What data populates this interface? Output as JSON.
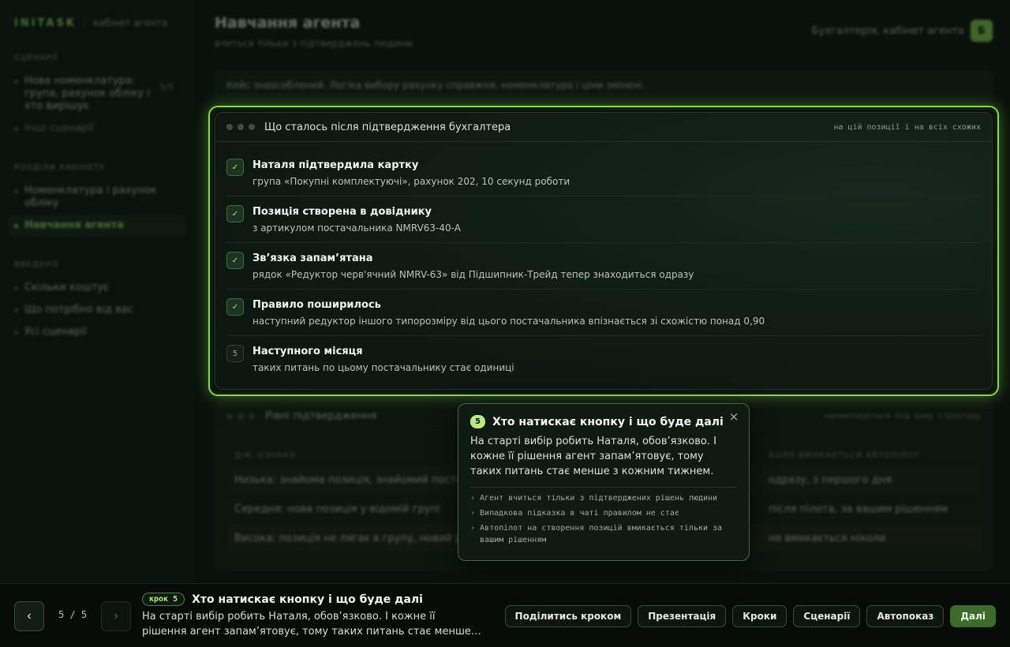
{
  "brand": {
    "logo": "INITASK",
    "subtitle": "кабінет агента"
  },
  "sidebar": {
    "sections": [
      {
        "title": "СЦЕНАРІЇ",
        "items": [
          {
            "label": "Нова номенклатура: група, рахунок обліку і хто вирішує",
            "count": "5/5"
          },
          {
            "label": "Інші сценарії"
          }
        ]
      },
      {
        "title": "РОЗДІЛИ КАБІНЕТУ",
        "items": [
          {
            "label": "Номенклатура і рахунок обліку"
          },
          {
            "label": "Навчання агента"
          }
        ]
      },
      {
        "title": "ВВЕДЕНО",
        "items": [
          {
            "label": "Скільки коштує"
          },
          {
            "label": "Що потрібно від вас"
          },
          {
            "label": "Усі сценарії"
          }
        ]
      }
    ]
  },
  "header": {
    "title": "Навчання агента",
    "subtitle": "вчиться тільки з підтверджень людини",
    "account_label": "Бухгалтерія, кабінет агента",
    "avatar_letter": "Б"
  },
  "banner": {
    "text": "Кейс знеособлений. Логіка вибору рахунку справжня, номенклатура і ціни змінені."
  },
  "window": {
    "title": "Що сталось після підтвердження бухгалтера",
    "note": "на цій позиції і на всіх схожих",
    "steps": [
      {
        "mark": "✓",
        "title": "Наталя підтвердила картку",
        "desc": "група «Покупні комплектуючі», рахунок 202, 10 секунд роботи"
      },
      {
        "mark": "✓",
        "title": "Позиція створена в довіднику",
        "desc": "з артикулом постачальника NMRV63-40-A"
      },
      {
        "mark": "✓",
        "title": "Зв’язка запам’ятана",
        "desc": "рядок «Редуктор черв'ячний NMRV-63» від Підшипник-Трейд тепер знаходиться одразу"
      },
      {
        "mark": "✓",
        "title": "Правило поширилось",
        "desc": "наступний редуктор іншого типорозміру від цього постачальника впізнається зі схожістю понад 0,90"
      },
      {
        "mark": "5",
        "title": "Наступного місяця",
        "desc": "таких питань по цьому постачальнику стає одиниці"
      }
    ]
  },
  "levels": {
    "title": "Рівні підтвердження",
    "note": "налаштовується під вашу структуру",
    "columns": [
      "ДІЯ: ОЗНАКИ",
      "КОЛИ ВМИКАЄТЬСЯ АВТОПІЛОТ"
    ],
    "rows": [
      [
        "Низька: знайома позиція, знайомий постачальник",
        "одразу, з першого дня"
      ],
      [
        "Середня: нова позиція у відомій групі",
        "після пілота, за вашим рішенням"
      ],
      [
        "Висока: позиція не лягає в групу, новий рахунок",
        "не вмикається ніколи"
      ]
    ]
  },
  "tooltip": {
    "num": "5",
    "title": "Хто натискає кнопку і що буде далі",
    "body": "На старті вибір робить Наталя, обов’язково. І кожне її рішення агент запам’ятовує, тому таких питань стає менше з кожним тижнем.",
    "bullets": [
      "Агент вчиться тільки з підтверджених рішень людини",
      "Випадкова підказка в чаті правилом не стає",
      "Автопілот на створення позицій вмикається тільки за вашим рішенням"
    ],
    "close": "×"
  },
  "tourbar": {
    "prev": "‹",
    "next": "›",
    "pager": "5 / 5",
    "step_pill": "крок 5",
    "title": "Хто натискає кнопку і що буде далі",
    "desc": "На старті вибір робить Наталя, обов’язково. І кожне її рішення агент запам’ятовує, тому таких питань стає менше з кожним тижнем.",
    "actions": [
      "Поділитись кроком",
      "Презентація",
      "Кроки",
      "Сценарії",
      "Автопоказ",
      "Далі"
    ]
  },
  "colors": {
    "accent": "#86d94c",
    "background": "#0a110c",
    "primary_button": "#3d6b2e"
  }
}
